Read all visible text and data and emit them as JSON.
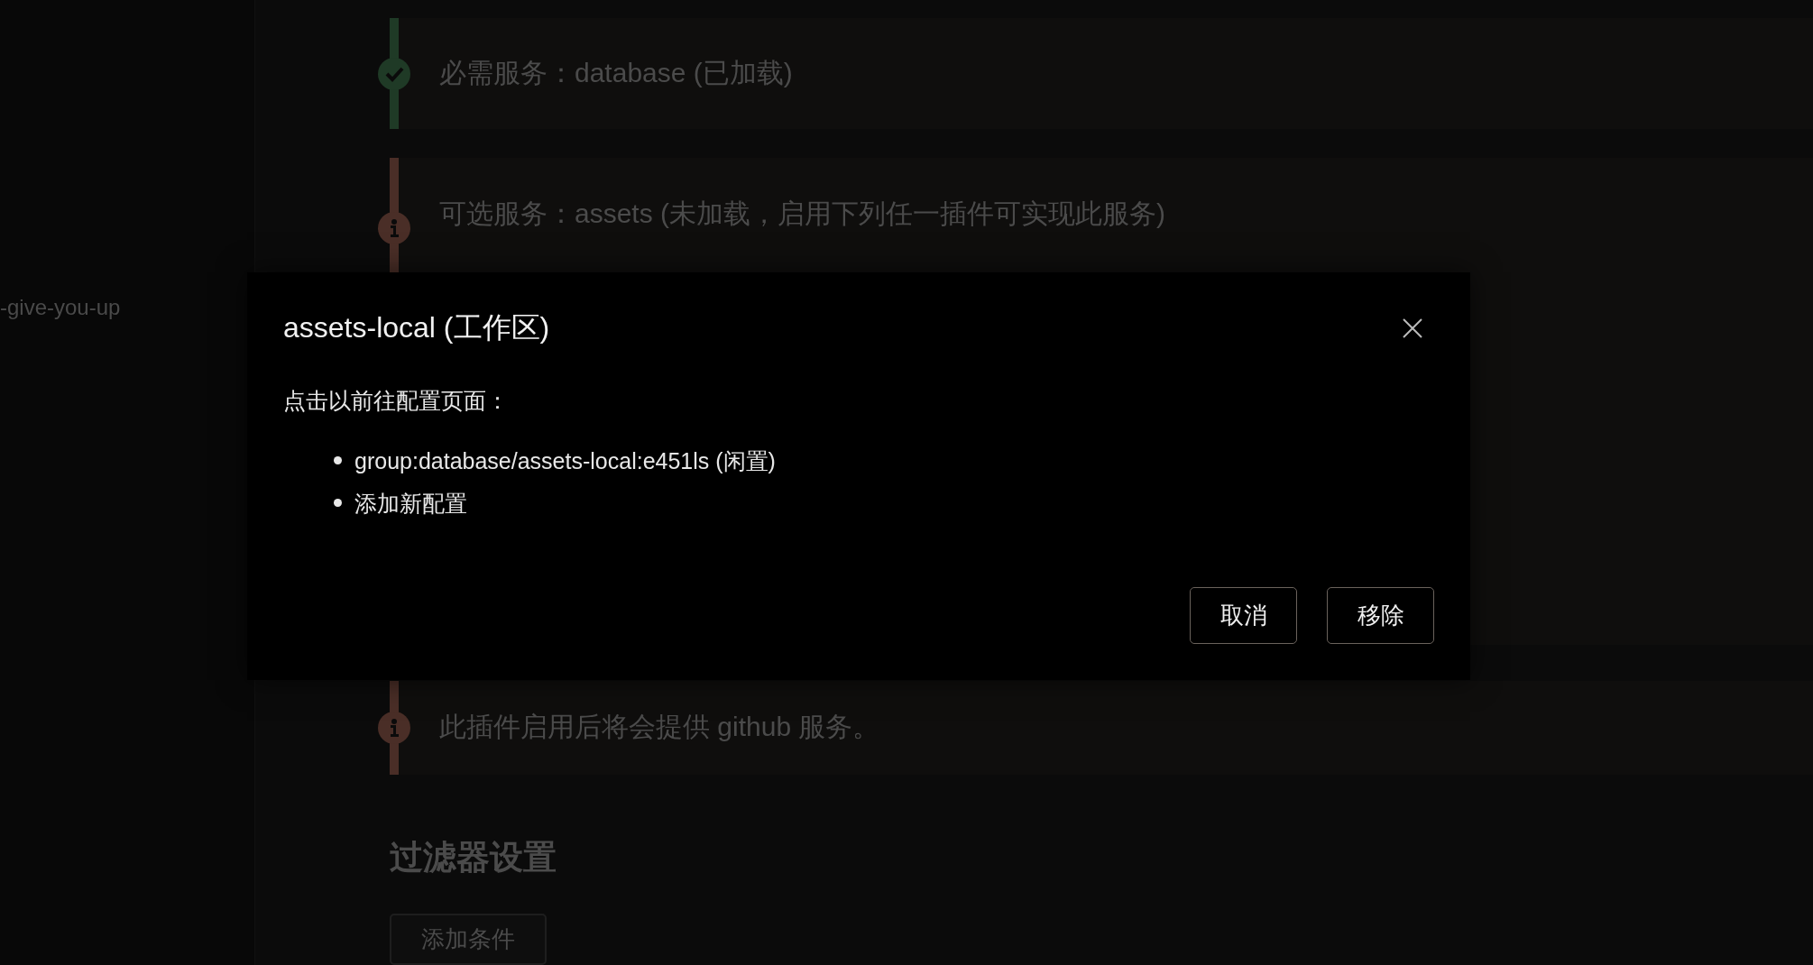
{
  "sidebar": {
    "items": [
      {
        "label": "-give-you-up"
      }
    ]
  },
  "services": [
    {
      "kind": "success",
      "text": "必需服务：database (已加载)"
    },
    {
      "kind": "info",
      "text": "可选服务：assets (未加载，启用下列任一插件可实现此服务)"
    },
    {
      "kind": "info",
      "text": "此插件启用后将会提供 github 服务。"
    }
  ],
  "filter": {
    "title": "过滤器设置",
    "add_button": "添加条件"
  },
  "dialog": {
    "title": "assets-local (工作区)",
    "message": "点击以前往配置页面：",
    "links": [
      "group:database/assets-local:e451ls (闲置)",
      "添加新配置"
    ],
    "buttons": [
      "取消",
      "移除"
    ]
  }
}
